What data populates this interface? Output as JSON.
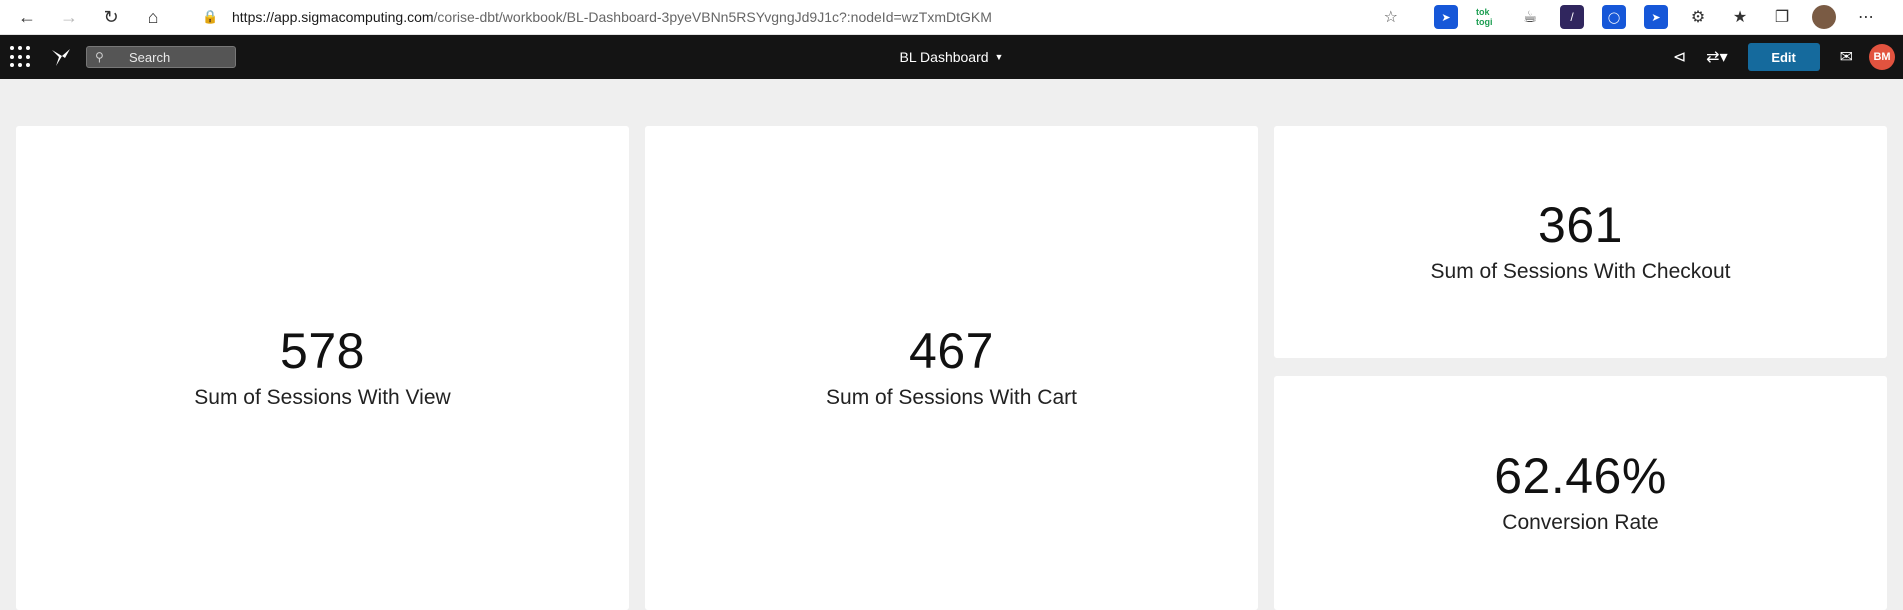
{
  "browser": {
    "url_host": "https://app.sigmacomputing.com",
    "url_path": "/corise-dbt/workbook/BL-Dashboard-3pyeVBNn5RSYvgngJd9J1c?:nodeId=wzTxmDtGKM",
    "extensions": [
      "tok togi"
    ]
  },
  "toolbar": {
    "search_label": "Search",
    "workbook_title": "BL Dashboard",
    "edit_label": "Edit",
    "avatar_initials": "BM"
  },
  "tiles": [
    {
      "value": "578",
      "label": "Sum of Sessions With View"
    },
    {
      "value": "467",
      "label": "Sum of Sessions With Cart"
    },
    {
      "value": "361",
      "label": "Sum of Sessions With Checkout"
    },
    {
      "value": "62.46%",
      "label": "Conversion Rate"
    }
  ],
  "colors": {
    "app_bar": "#141414",
    "edit_button": "#156a9d",
    "avatar": "#e2533f",
    "canvas": "#efefef"
  }
}
